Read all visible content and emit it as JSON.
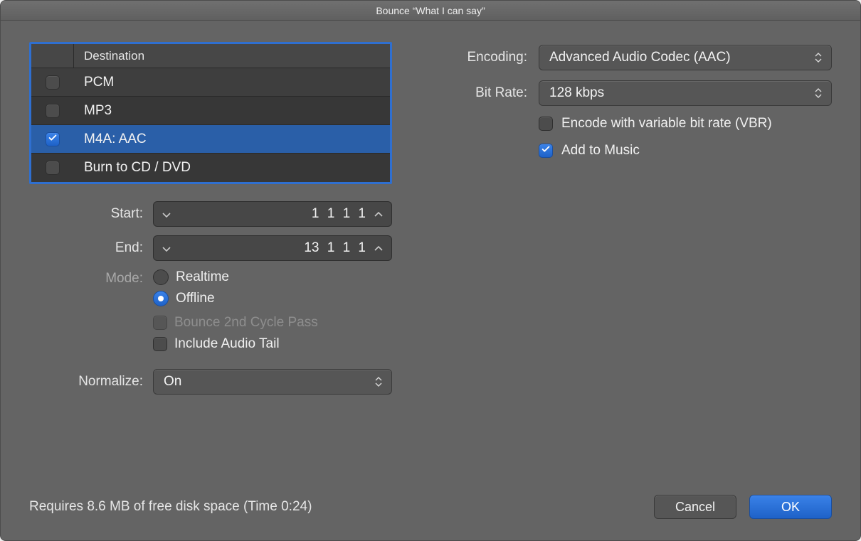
{
  "window": {
    "title": "Bounce “What I can say”"
  },
  "destination": {
    "header": "Destination",
    "items": [
      {
        "label": "PCM",
        "checked": false,
        "selected": false
      },
      {
        "label": "MP3",
        "checked": false,
        "selected": false
      },
      {
        "label": "M4A: AAC",
        "checked": true,
        "selected": true
      },
      {
        "label": "Burn to CD / DVD",
        "checked": false,
        "selected": false
      }
    ]
  },
  "range": {
    "start_label": "Start:",
    "start_value": "1 1 1   1",
    "end_label": "End:",
    "end_value": "13 1 1   1"
  },
  "mode": {
    "label": "Mode:",
    "realtime": "Realtime",
    "offline": "Offline",
    "selected": "offline",
    "bounce2nd": "Bounce 2nd Cycle Pass",
    "bounce2nd_enabled": false,
    "include_tail": "Include Audio Tail",
    "include_tail_checked": false
  },
  "normalize": {
    "label": "Normalize:",
    "value": "On"
  },
  "encoding": {
    "label": "Encoding:",
    "value": "Advanced Audio Codec (AAC)"
  },
  "bitrate": {
    "label": "Bit Rate:",
    "value": "128 kbps"
  },
  "vbr": {
    "label": "Encode with variable bit rate (VBR)",
    "checked": false
  },
  "add_to_music": {
    "label": "Add to Music",
    "checked": true
  },
  "footer": {
    "status": "Requires 8.6 MB of free disk space  (Time 0:24)",
    "cancel": "Cancel",
    "ok": "OK"
  }
}
